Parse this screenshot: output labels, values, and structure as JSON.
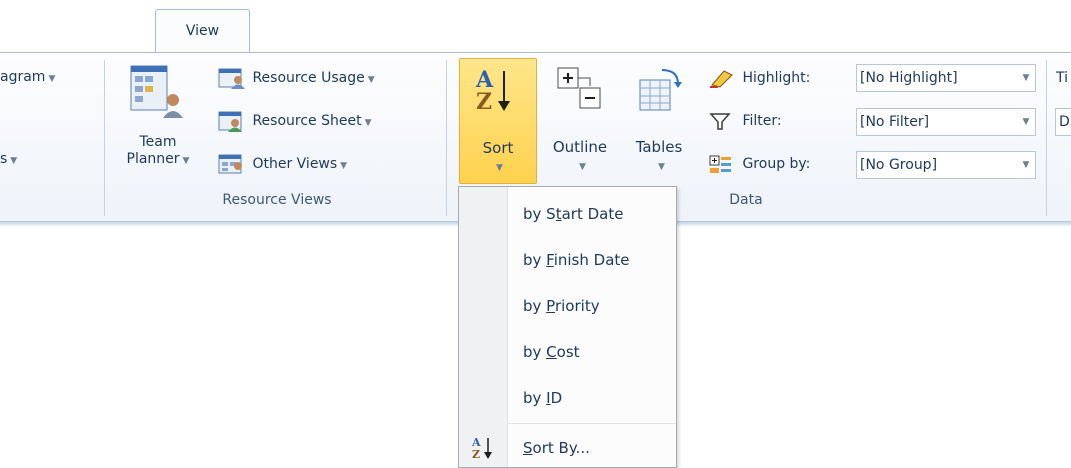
{
  "tabs": {
    "active": "View"
  },
  "left_cut": {
    "diagram_label": "agram",
    "views_label": "s"
  },
  "resource_views": {
    "team_planner_line1": "Team",
    "team_planner_line2": "Planner",
    "resource_usage": "Resource Usage",
    "resource_sheet": "Resource Sheet",
    "other_views": "Other Views",
    "group_label": "Resource Views"
  },
  "data_group": {
    "sort_label": "Sort",
    "outline_label": "Outline",
    "tables_label": "Tables",
    "highlight_label": "Highlight:",
    "highlight_value": "[No Highlight]",
    "filter_label": "Filter:",
    "filter_value": "[No Filter]",
    "groupby_label": "Group by:",
    "groupby_value": "[No Group]",
    "group_label": "Data"
  },
  "right_cut": {
    "ti_label": "Ti",
    "d_label": "D"
  },
  "sort_menu": {
    "items": [
      {
        "pre": "by S",
        "key": "t",
        "post": "art Date"
      },
      {
        "pre": "by ",
        "key": "F",
        "post": "inish Date"
      },
      {
        "pre": "by ",
        "key": "P",
        "post": "riority"
      },
      {
        "pre": "by ",
        "key": "C",
        "post": "ost"
      },
      {
        "pre": "by ",
        "key": "I",
        "post": "D"
      }
    ],
    "sort_by": {
      "key": "S",
      "post": "ort By..."
    }
  },
  "colors": {
    "accent_sort": "#ffd24f",
    "ribbon_border": "#a9bdd6",
    "text": "#1e395b"
  }
}
